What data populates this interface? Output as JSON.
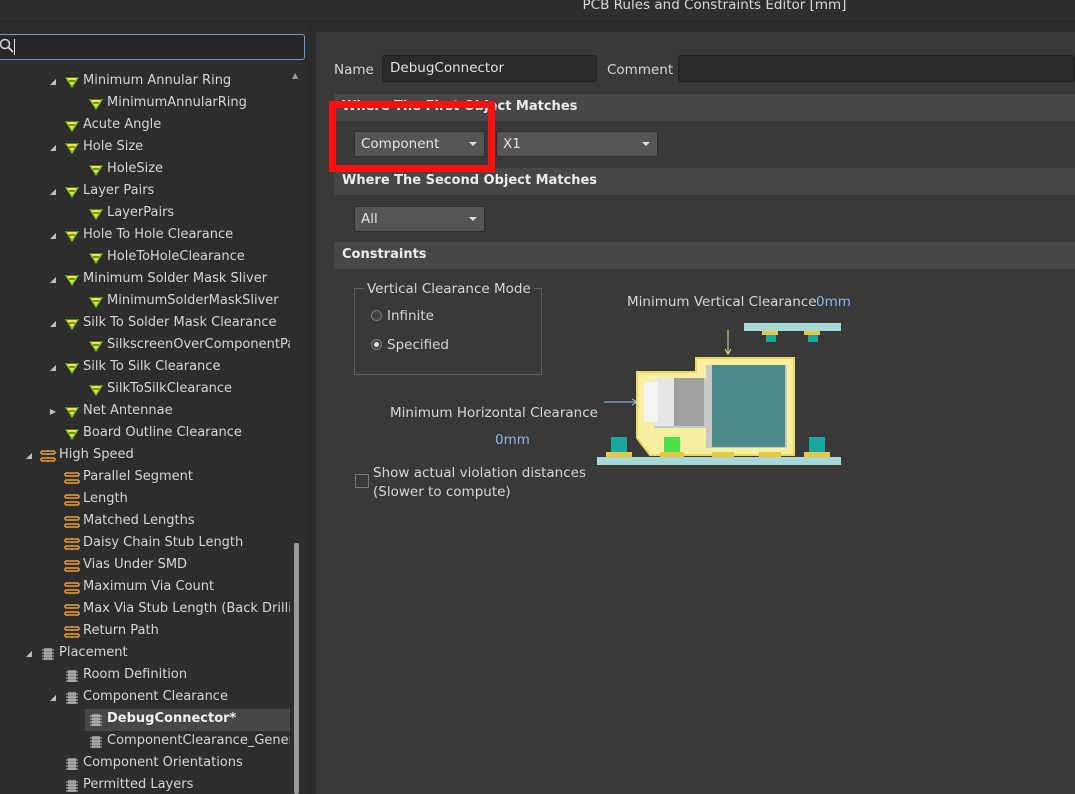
{
  "window": {
    "title": "PCB Rules and Constraints Editor [mm]"
  },
  "search": {
    "value": "",
    "placeholder": ""
  },
  "tree": [
    {
      "label": "Minimum Annular Ring",
      "level": 1,
      "expander": "collapse",
      "icon": "rule-icon"
    },
    {
      "label": "MinimumAnnularRing",
      "level": 2,
      "expander": "",
      "icon": "rule-icon"
    },
    {
      "label": "Acute Angle",
      "level": 1,
      "expander": "",
      "icon": "rule-icon"
    },
    {
      "label": "Hole Size",
      "level": 1,
      "expander": "collapse",
      "icon": "rule-icon"
    },
    {
      "label": "HoleSize",
      "level": 2,
      "expander": "",
      "icon": "rule-icon"
    },
    {
      "label": "Layer Pairs",
      "level": 1,
      "expander": "collapse",
      "icon": "rule-icon"
    },
    {
      "label": "LayerPairs",
      "level": 2,
      "expander": "",
      "icon": "rule-icon"
    },
    {
      "label": "Hole To Hole Clearance",
      "level": 1,
      "expander": "collapse",
      "icon": "rule-icon"
    },
    {
      "label": "HoleToHoleClearance",
      "level": 2,
      "expander": "",
      "icon": "rule-icon"
    },
    {
      "label": "Minimum Solder Mask Sliver",
      "level": 1,
      "expander": "collapse",
      "icon": "rule-icon"
    },
    {
      "label": "MinimumSolderMaskSliver",
      "level": 2,
      "expander": "",
      "icon": "rule-icon"
    },
    {
      "label": "Silk To Solder Mask Clearance",
      "level": 1,
      "expander": "collapse",
      "icon": "rule-icon"
    },
    {
      "label": "SilkscreenOverComponentPad",
      "level": 2,
      "expander": "",
      "icon": "rule-icon"
    },
    {
      "label": "Silk To Silk Clearance",
      "level": 1,
      "expander": "collapse",
      "icon": "rule-icon"
    },
    {
      "label": "SilkToSilkClearance",
      "level": 2,
      "expander": "",
      "icon": "rule-icon"
    },
    {
      "label": "Net Antennae",
      "level": 1,
      "expander": "expand",
      "icon": "rule-icon"
    },
    {
      "label": "Board Outline Clearance",
      "level": 1,
      "expander": "",
      "icon": "rule-icon"
    },
    {
      "label": "High Speed",
      "level": 0,
      "expander": "collapse",
      "icon": "highspeed-icon"
    },
    {
      "label": "Parallel Segment",
      "level": 1,
      "expander": "",
      "icon": "highspeed-icon"
    },
    {
      "label": "Length",
      "level": 1,
      "expander": "",
      "icon": "highspeed-icon"
    },
    {
      "label": "Matched Lengths",
      "level": 1,
      "expander": "",
      "icon": "highspeed-icon"
    },
    {
      "label": "Daisy Chain Stub Length",
      "level": 1,
      "expander": "",
      "icon": "highspeed-icon"
    },
    {
      "label": "Vias Under SMD",
      "level": 1,
      "expander": "",
      "icon": "highspeed-icon"
    },
    {
      "label": "Maximum Via Count",
      "level": 1,
      "expander": "",
      "icon": "highspeed-icon"
    },
    {
      "label": "Max Via Stub Length (Back Drilling)",
      "level": 1,
      "expander": "",
      "icon": "highspeed-icon"
    },
    {
      "label": "Return Path",
      "level": 1,
      "expander": "",
      "icon": "highspeed-icon"
    },
    {
      "label": "Placement",
      "level": 0,
      "expander": "collapse",
      "icon": "placement-icon"
    },
    {
      "label": "Room Definition",
      "level": 1,
      "expander": "",
      "icon": "placement-icon"
    },
    {
      "label": "Component Clearance",
      "level": 1,
      "expander": "collapse",
      "icon": "placement-icon"
    },
    {
      "label": "DebugConnector*",
      "level": 2,
      "expander": "",
      "icon": "placement-icon",
      "selected": true
    },
    {
      "label": "ComponentClearance_General",
      "level": 2,
      "expander": "",
      "icon": "placement-icon"
    },
    {
      "label": "Component Orientations",
      "level": 1,
      "expander": "",
      "icon": "placement-icon"
    },
    {
      "label": "Permitted Layers",
      "level": 1,
      "expander": "",
      "icon": "placement-icon"
    }
  ],
  "rule": {
    "name_label": "Name",
    "name_value": "DebugConnector",
    "comment_label": "Comment",
    "comment_value": ""
  },
  "first_match": {
    "header": "Where The First Object Matches",
    "type_selected": "Component",
    "value_selected": "X1"
  },
  "second_match": {
    "header": "Where The Second Object Matches",
    "type_selected": "All"
  },
  "constraints": {
    "header": "Constraints",
    "mode_group_title": "Vertical Clearance Mode",
    "mode_infinite": "Infinite",
    "mode_specified": "Specified",
    "mode_selected": "Specified",
    "min_vertical_label": "Minimum Vertical Clearance",
    "min_vertical_value": "0mm",
    "min_horizontal_label": "Minimum Horizontal Clearance",
    "min_horizontal_value": "0mm",
    "show_violation_line1": "Show actual violation distances",
    "show_violation_line2": "(Slower to compute)",
    "show_violation_checked": false
  },
  "colors": {
    "highlight": "#ff0f0f",
    "value_blue": "#8fb8e8",
    "rule_icon_green": "#7ed321",
    "highspeed_orange": "#f0a030"
  }
}
